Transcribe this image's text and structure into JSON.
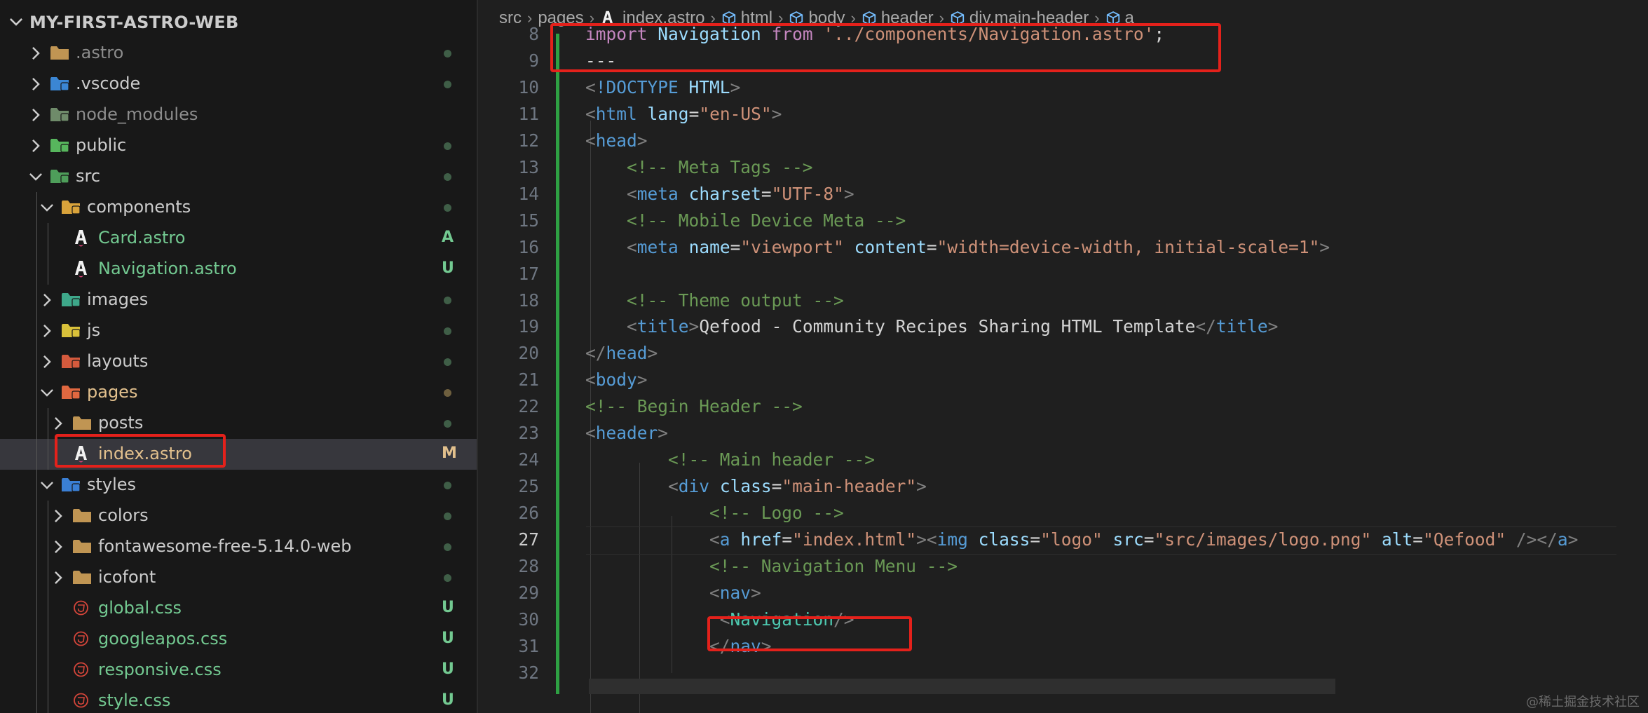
{
  "sidebar": {
    "title": "MY-FIRST-ASTRO-WEB",
    "items": [
      {
        "label": ".astro",
        "status": "",
        "icon": "folder-icon"
      },
      {
        "label": ".vscode",
        "status": "",
        "icon": "vscode-folder-icon"
      },
      {
        "label": "node_modules",
        "status": "",
        "icon": "node-modules-folder-icon"
      },
      {
        "label": "public",
        "status": "",
        "icon": "public-folder-icon"
      },
      {
        "label": "src",
        "status": "",
        "icon": "src-folder-icon"
      },
      {
        "label": "components",
        "status": "",
        "icon": "components-folder-icon"
      },
      {
        "label": "Card.astro",
        "status": "A",
        "icon": "astro-file-icon"
      },
      {
        "label": "Navigation.astro",
        "status": "U",
        "icon": "astro-file-icon"
      },
      {
        "label": "images",
        "status": "",
        "icon": "images-folder-icon"
      },
      {
        "label": "js",
        "status": "",
        "icon": "js-folder-icon"
      },
      {
        "label": "layouts",
        "status": "",
        "icon": "layouts-folder-icon"
      },
      {
        "label": "pages",
        "status": "",
        "icon": "pages-folder-icon"
      },
      {
        "label": "posts",
        "status": "",
        "icon": "folder-icon"
      },
      {
        "label": "index.astro",
        "status": "M",
        "icon": "astro-file-icon"
      },
      {
        "label": "styles",
        "status": "",
        "icon": "styles-folder-icon"
      },
      {
        "label": "colors",
        "status": "",
        "icon": "folder-icon"
      },
      {
        "label": "fontawesome-free-5.14.0-web",
        "status": "",
        "icon": "folder-icon"
      },
      {
        "label": "icofont",
        "status": "",
        "icon": "folder-icon"
      },
      {
        "label": "global.css",
        "status": "U",
        "icon": "css-file-icon"
      },
      {
        "label": "googleapos.css",
        "status": "U",
        "icon": "css-file-icon"
      },
      {
        "label": "responsive.css",
        "status": "U",
        "icon": "css-file-icon"
      },
      {
        "label": "style.css",
        "status": "U",
        "icon": "css-file-icon"
      }
    ]
  },
  "breadcrumb": [
    "src",
    "pages",
    "index.astro",
    "html",
    "body",
    "header",
    "div.main-header",
    "a"
  ],
  "editor": {
    "active_line": "27",
    "lines": [
      {
        "n": "8",
        "parts": [
          [
            "kw",
            "import"
          ],
          [
            "text",
            " "
          ],
          [
            "id",
            "Navigation"
          ],
          [
            "text",
            " "
          ],
          [
            "kw",
            "from"
          ],
          [
            "text",
            " "
          ],
          [
            "str",
            "'../components/Navigation.astro'"
          ],
          [
            "punc",
            ";"
          ]
        ]
      },
      {
        "n": "9",
        "parts": [
          [
            "punc",
            "---"
          ]
        ]
      },
      {
        "n": "10",
        "parts": [
          [
            "br",
            "<"
          ],
          [
            "tag",
            "!DOCTYPE"
          ],
          [
            "text",
            " "
          ],
          [
            "attr",
            "HTML"
          ],
          [
            "br",
            ">"
          ]
        ]
      },
      {
        "n": "11",
        "parts": [
          [
            "br",
            "<"
          ],
          [
            "tag",
            "html"
          ],
          [
            "text",
            " "
          ],
          [
            "attr",
            "lang"
          ],
          [
            "text",
            "="
          ],
          [
            "str",
            "\"en-US\""
          ],
          [
            "br",
            ">"
          ]
        ]
      },
      {
        "n": "12",
        "parts": [
          [
            "br",
            "<"
          ],
          [
            "tag",
            "head"
          ],
          [
            "br",
            ">"
          ]
        ]
      },
      {
        "n": "13",
        "parts": [
          [
            "text",
            "    "
          ],
          [
            "cmt",
            "<!-- Meta Tags -->"
          ]
        ]
      },
      {
        "n": "14",
        "parts": [
          [
            "text",
            "    "
          ],
          [
            "br",
            "<"
          ],
          [
            "tag",
            "meta"
          ],
          [
            "text",
            " "
          ],
          [
            "attr",
            "charset"
          ],
          [
            "text",
            "="
          ],
          [
            "str",
            "\"UTF-8\""
          ],
          [
            "br",
            ">"
          ]
        ]
      },
      {
        "n": "15",
        "parts": [
          [
            "text",
            "    "
          ],
          [
            "cmt",
            "<!-- Mobile Device Meta -->"
          ]
        ]
      },
      {
        "n": "16",
        "parts": [
          [
            "text",
            "    "
          ],
          [
            "br",
            "<"
          ],
          [
            "tag",
            "meta"
          ],
          [
            "text",
            " "
          ],
          [
            "attr",
            "name"
          ],
          [
            "text",
            "="
          ],
          [
            "str",
            "\"viewport\""
          ],
          [
            "text",
            " "
          ],
          [
            "attr",
            "content"
          ],
          [
            "text",
            "="
          ],
          [
            "str",
            "\"width=device-width, initial-scale=1\""
          ],
          [
            "br",
            ">"
          ]
        ]
      },
      {
        "n": "17",
        "parts": []
      },
      {
        "n": "18",
        "parts": [
          [
            "text",
            "    "
          ],
          [
            "cmt",
            "<!-- Theme output -->"
          ]
        ]
      },
      {
        "n": "19",
        "parts": [
          [
            "text",
            "    "
          ],
          [
            "br",
            "<"
          ],
          [
            "tag",
            "title"
          ],
          [
            "br",
            ">"
          ],
          [
            "text",
            "Qefood - Community Recipes Sharing HTML Template"
          ],
          [
            "br",
            "</"
          ],
          [
            "tag",
            "title"
          ],
          [
            "br",
            ">"
          ]
        ]
      },
      {
        "n": "20",
        "parts": [
          [
            "br",
            "</"
          ],
          [
            "tag",
            "head"
          ],
          [
            "br",
            ">"
          ]
        ]
      },
      {
        "n": "21",
        "parts": [
          [
            "br",
            "<"
          ],
          [
            "tag",
            "body"
          ],
          [
            "br",
            ">"
          ]
        ]
      },
      {
        "n": "22",
        "parts": [
          [
            "cmt",
            "<!-- Begin Header -->"
          ]
        ]
      },
      {
        "n": "23",
        "parts": [
          [
            "br",
            "<"
          ],
          [
            "tag",
            "header"
          ],
          [
            "br",
            ">"
          ]
        ]
      },
      {
        "n": "24",
        "parts": [
          [
            "text",
            "        "
          ],
          [
            "cmt",
            "<!-- Main header -->"
          ]
        ]
      },
      {
        "n": "25",
        "parts": [
          [
            "text",
            "        "
          ],
          [
            "br",
            "<"
          ],
          [
            "tag",
            "div"
          ],
          [
            "text",
            " "
          ],
          [
            "attr",
            "class"
          ],
          [
            "text",
            "="
          ],
          [
            "str",
            "\"main-header\""
          ],
          [
            "br",
            ">"
          ]
        ]
      },
      {
        "n": "26",
        "parts": [
          [
            "text",
            "            "
          ],
          [
            "cmt",
            "<!-- Logo -->"
          ]
        ]
      },
      {
        "n": "27",
        "parts": [
          [
            "text",
            "            "
          ],
          [
            "br",
            "<"
          ],
          [
            "tag",
            "a"
          ],
          [
            "text",
            " "
          ],
          [
            "attr",
            "href"
          ],
          [
            "text",
            "="
          ],
          [
            "str",
            "\"index.html\""
          ],
          [
            "br",
            "><"
          ],
          [
            "tag",
            "img"
          ],
          [
            "text",
            " "
          ],
          [
            "attr",
            "class"
          ],
          [
            "text",
            "="
          ],
          [
            "str",
            "\"logo\""
          ],
          [
            "text",
            " "
          ],
          [
            "attr",
            "src"
          ],
          [
            "text",
            "="
          ],
          [
            "str",
            "\"src/images/logo.png\""
          ],
          [
            "text",
            " "
          ],
          [
            "attr",
            "alt"
          ],
          [
            "text",
            "="
          ],
          [
            "str",
            "\"Qefood\""
          ],
          [
            "text",
            " "
          ],
          [
            "br",
            "/></"
          ],
          [
            "tag",
            "a"
          ],
          [
            "br",
            ">"
          ]
        ]
      },
      {
        "n": "28",
        "parts": [
          [
            "text",
            "            "
          ],
          [
            "cmt",
            "<!-- Navigation Menu -->"
          ]
        ]
      },
      {
        "n": "29",
        "parts": [
          [
            "text",
            "            "
          ],
          [
            "br",
            "<"
          ],
          [
            "tag",
            "nav"
          ],
          [
            "br",
            ">"
          ]
        ]
      },
      {
        "n": "30",
        "parts": [
          [
            "text",
            "             "
          ],
          [
            "br",
            "<"
          ],
          [
            "tagname",
            "Navigation"
          ],
          [
            "br",
            "/>"
          ]
        ]
      },
      {
        "n": "31",
        "parts": [
          [
            "text",
            "            "
          ],
          [
            "br",
            "</"
          ],
          [
            "tag",
            "nav"
          ],
          [
            "br",
            ">"
          ]
        ]
      },
      {
        "n": "32",
        "parts": []
      }
    ]
  },
  "watermark": "@稀土掘金技术社区",
  "colors": {
    "highlight": "#e4211b",
    "git_added": "#2ea043",
    "status_untracked": "#73c991",
    "status_modified": "#e2c08d"
  }
}
